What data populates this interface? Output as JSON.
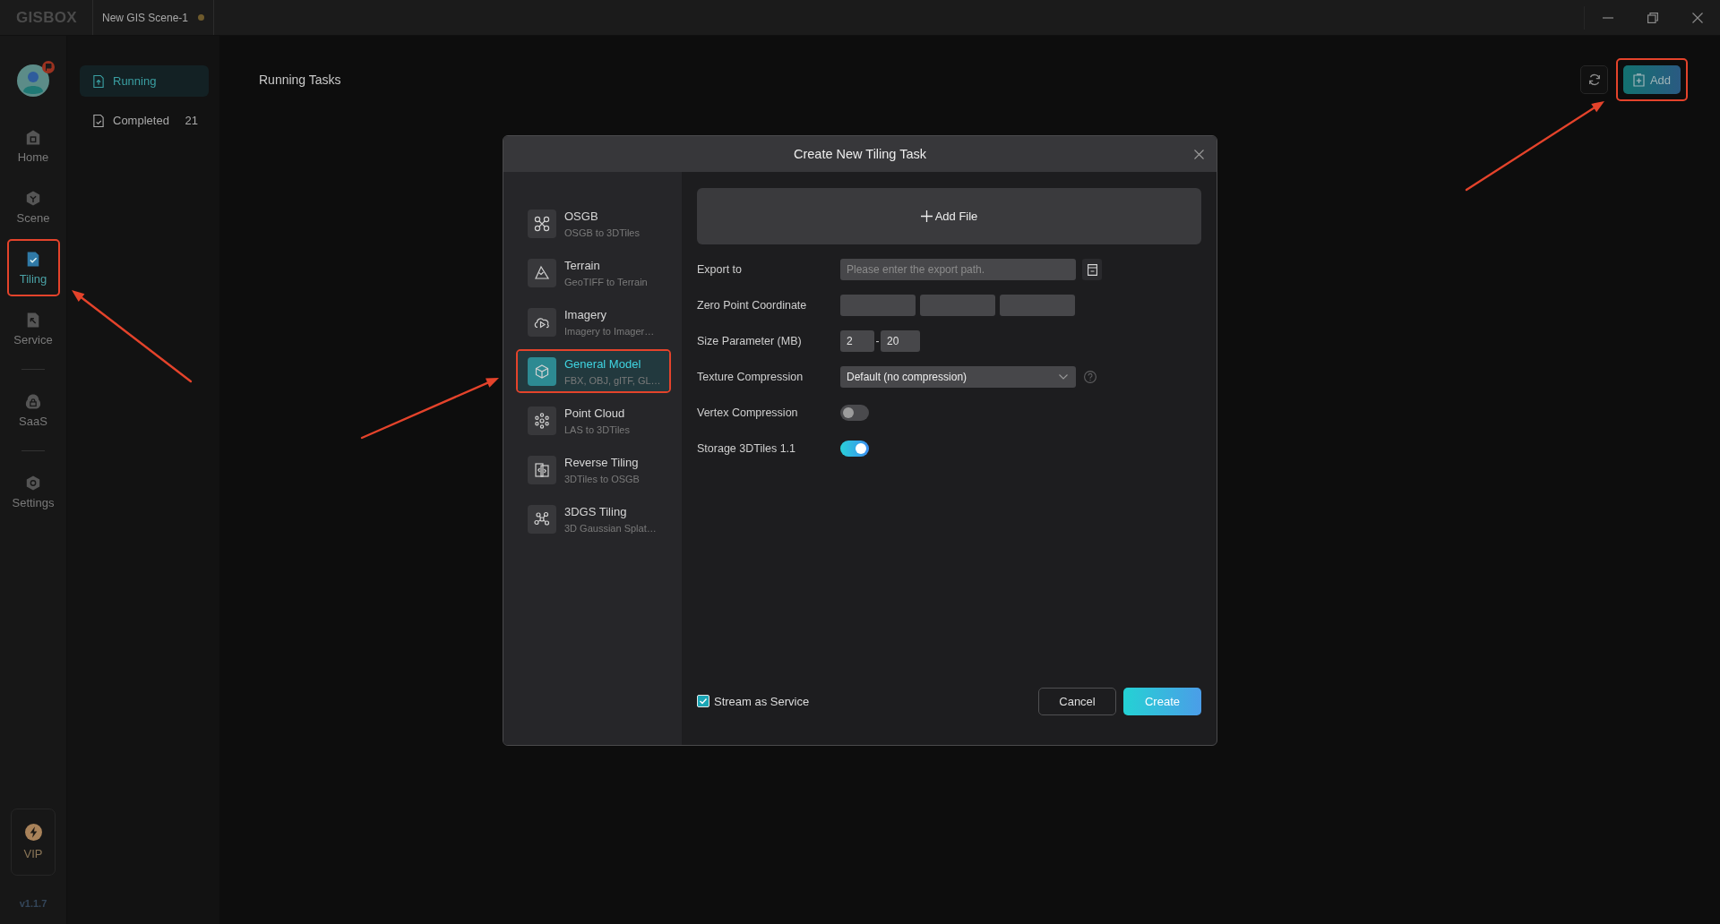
{
  "title_bar": {
    "logo": "GISBOX",
    "tabs": [
      {
        "label": "New GIS Scene-1",
        "modified": true
      }
    ]
  },
  "rail": {
    "groups": [
      {
        "items": [
          {
            "label": "Home",
            "selected": false,
            "annotated": false
          },
          {
            "label": "Scene",
            "selected": false,
            "annotated": false
          },
          {
            "label": "Tiling",
            "selected": true,
            "annotated": true
          },
          {
            "label": "Service",
            "selected": false,
            "annotated": false
          }
        ]
      },
      {
        "items": [
          {
            "label": "SaaS",
            "selected": false,
            "annotated": false
          }
        ]
      },
      {
        "items": [
          {
            "label": "Settings",
            "selected": false,
            "annotated": false
          }
        ]
      }
    ],
    "vip": {
      "label": "VIP"
    },
    "version": "v1.1.7"
  },
  "task_filters": [
    {
      "label": "Running",
      "selected": true
    },
    {
      "label": "Completed",
      "count": "21",
      "selected": false
    }
  ],
  "main": {
    "title": "Running Tasks",
    "toolbar": [
      {
        "kind": "refresh",
        "annotated": false
      },
      {
        "kind": "add",
        "label": "Add",
        "annotated": true
      }
    ]
  },
  "dialog": {
    "title": "Create New Tiling Task",
    "task_types": [
      {
        "name": "OSGB",
        "description": "OSGB to 3DTiles",
        "selected": false,
        "annotated": false
      },
      {
        "name": "Terrain",
        "description": "GeoTIFF to Terrain",
        "selected": false,
        "annotated": false
      },
      {
        "name": "Imagery",
        "description": "Imagery to Imager…",
        "selected": false,
        "annotated": false
      },
      {
        "name": "General Model",
        "description": "FBX, OBJ, glTF, GL…",
        "selected": true,
        "annotated": true
      },
      {
        "name": "Point Cloud",
        "description": "LAS to 3DTiles",
        "selected": false,
        "annotated": false
      },
      {
        "name": "Reverse Tiling",
        "description": "3DTiles to OSGB",
        "selected": false,
        "annotated": false
      },
      {
        "name": "3DGS Tiling",
        "description": "3D Gaussian Splat…",
        "selected": false,
        "annotated": false
      }
    ],
    "add_file": {
      "label": "Add File"
    },
    "fields": [
      {
        "kind": "path",
        "label": "Export to",
        "placeholder": "Please enter the export path."
      },
      {
        "kind": "coordinate",
        "label": "Zero Point Coordinate"
      },
      {
        "kind": "range",
        "label": "Size Parameter (MB)",
        "min": "2",
        "separator": "-",
        "max": "20"
      },
      {
        "kind": "select",
        "label": "Texture Compression",
        "value": "Default (no compression)"
      },
      {
        "kind": "toggle",
        "label": "Vertex Compression",
        "on": false
      },
      {
        "kind": "toggle",
        "label": "Storage 3DTiles 1.1",
        "on": true
      }
    ],
    "stream_option": {
      "label": "Stream as Service",
      "checked": true
    },
    "buttons": [
      {
        "kind": "secondary",
        "label": "Cancel"
      },
      {
        "kind": "primary",
        "label": "Create"
      }
    ]
  }
}
